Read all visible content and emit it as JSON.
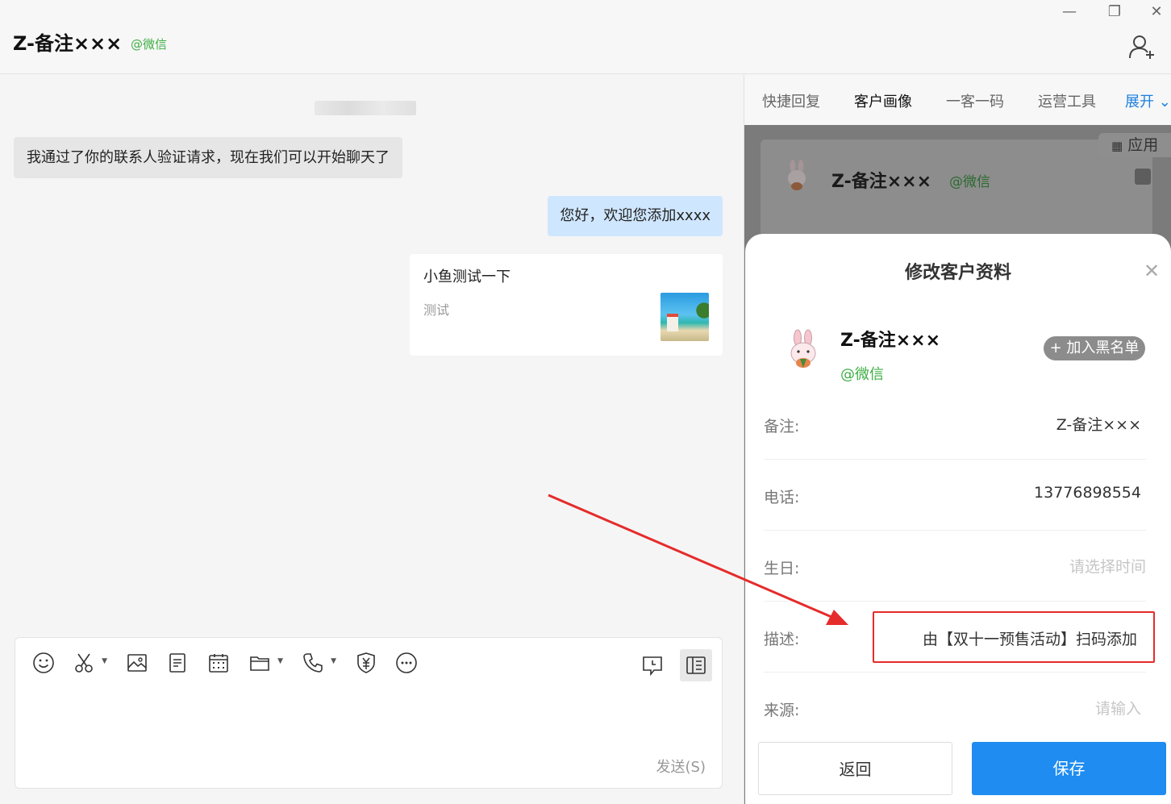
{
  "window": {
    "contact_title": "Z-备注×××",
    "contact_source": "@微信",
    "min_glyph": "—",
    "max_glyph": "❐",
    "close_glyph": "✕"
  },
  "chat": {
    "system_message": "我通过了你的联系人验证请求，现在我们可以开始聊天了",
    "outgoing_message": "您好，欢迎您添加xxxx",
    "card": {
      "title": "小鱼测试一下",
      "description": "测试"
    },
    "send_label": "发送(S)"
  },
  "tabs": [
    {
      "label": "快捷回复"
    },
    {
      "label": "客户画像"
    },
    {
      "label": "一客一码"
    },
    {
      "label": "运营工具"
    },
    {
      "label": "展开 ⌄"
    }
  ],
  "profile_bg": {
    "app_label": "应用",
    "name": "Z-备注×××",
    "source": "@微信"
  },
  "modal": {
    "title": "修改客户资料",
    "close_glyph": "✕",
    "name": "Z-备注×××",
    "source": "@微信",
    "blacklist_label": "+ 加入黑名单",
    "fields": {
      "remark": {
        "label": "备注:",
        "value": "Z-备注×××"
      },
      "phone": {
        "label": "电话:",
        "value": "13776898554"
      },
      "birthday": {
        "label": "生日:",
        "placeholder": "请选择时间"
      },
      "description": {
        "label": "描述:",
        "value": "由【双十一预售活动】扫码添加"
      },
      "source": {
        "label": "来源:",
        "placeholder": "请输入"
      }
    },
    "back_label": "返回",
    "save_label": "保存"
  },
  "colors": {
    "accent": "#1e8cf0",
    "source_green": "#3fae45",
    "highlight_red": "#e62b2b",
    "outgoing_bubble": "#cfe6ff"
  }
}
